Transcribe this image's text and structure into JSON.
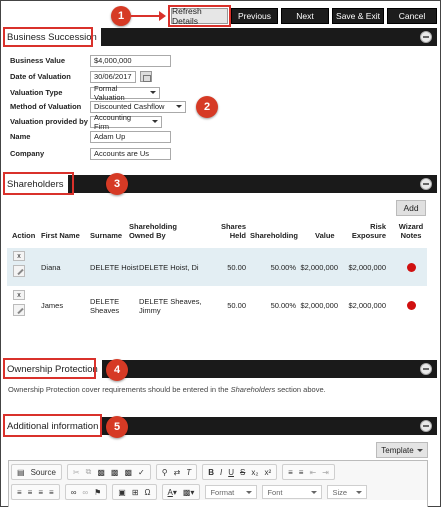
{
  "toolbar": {
    "refresh": "Refresh Details",
    "previous": "Previous",
    "next": "Next",
    "save_exit": "Save & Exit",
    "cancel": "Cancel"
  },
  "callouts": [
    "1",
    "2",
    "3",
    "4",
    "5"
  ],
  "sections": {
    "business": "Business Succession",
    "shareholders": "Shareholders",
    "ownership": "Ownership Protection",
    "additional": "Additional information"
  },
  "business": {
    "value_label": "Business Value",
    "value": "$4,000,000",
    "date_label": "Date of Valuation",
    "date": "30/06/2017",
    "type_label": "Valuation Type",
    "type": "Formal Valuation",
    "method_label": "Method of Valuation",
    "method": "Discounted Cashflow",
    "provided_label": "Valuation provided by",
    "provided": "Accounting Firm",
    "name_label": "Name",
    "name": "Adam Up",
    "company_label": "Company",
    "company": "Accounts are Us"
  },
  "shareholders": {
    "add": "Add",
    "columns": {
      "action": "Action",
      "first": "First Name",
      "surname": "Surname",
      "owned": "Shareholding Owned By",
      "shares": "Shares Held",
      "holding": "Shareholding",
      "value": "Value",
      "risk": "Risk Exposure",
      "notes": "Wizard Notes"
    },
    "rows": [
      {
        "x": "x",
        "first": "Diana",
        "surname": "DELETE Hoist",
        "owned": "DELETE Hoist, Di",
        "shares": "50.00",
        "holding": "50.00%",
        "value": "$2,000,000",
        "risk": "$2,000,000"
      },
      {
        "x": "x",
        "first": "James",
        "surname": "DELETE Sheaves",
        "owned": "DELETE Sheaves, Jimmy",
        "shares": "50.00",
        "holding": "50.00%",
        "value": "$2,000,000",
        "risk": "$2,000,000"
      }
    ]
  },
  "ownership": {
    "note_before": "Ownership Protection cover requirements should be entered in the ",
    "note_em": "Shareholders",
    "note_after": " section above."
  },
  "editor": {
    "template": "Template",
    "source": "Source",
    "format": "Format",
    "font": "Font",
    "size": "Size"
  },
  "colors": {
    "accent": "#d9312b",
    "header_bg": "#1a1a1a",
    "row_highlight": "#e3eef3",
    "status_red": "#d01010"
  }
}
